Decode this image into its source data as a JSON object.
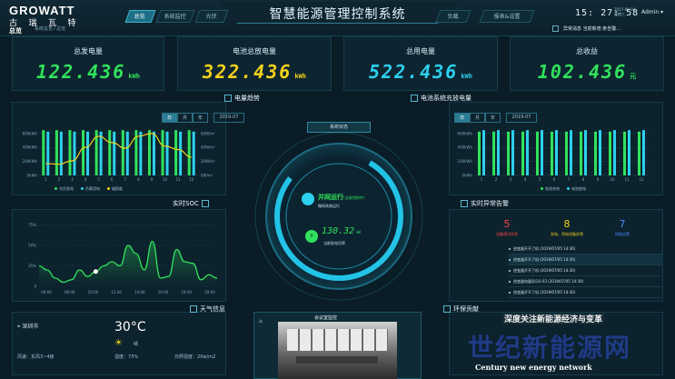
{
  "header": {
    "logo_en": "GROWATT",
    "logo_cn": "古 瑞 瓦 特",
    "logo_sub": "系统总览 / 总览",
    "overview": "总览",
    "title": "智慧能源管理控制系统",
    "clock": "15: 27: 58",
    "date": "2017-09-04",
    "weekday": "星期三",
    "admin": "Admin",
    "alarm": "异常消息  当前新增:条告警…"
  },
  "nav_left": [
    {
      "label": "总览",
      "active": true
    },
    {
      "label": "系统监控",
      "active": false
    },
    {
      "label": "光伏",
      "active": false
    }
  ],
  "nav_right": [
    {
      "label": "负载",
      "active": false
    },
    {
      "label": "报表&设置",
      "active": false
    }
  ],
  "kpis": [
    {
      "label": "总发电量",
      "value": "122.436",
      "unit": "kWh",
      "color": "#31e25c"
    },
    {
      "label": "电池总放电量",
      "value": "322.436",
      "unit": "kWh",
      "color": "#f5d21b"
    },
    {
      "label": "总用电量",
      "value": "522.436",
      "unit": "kWh",
      "color": "#2dd0ee"
    },
    {
      "label": "总收益",
      "value": "102.436",
      "unit": "元",
      "color": "#31e25c"
    }
  ],
  "energy_trend": {
    "title": "电量趋势",
    "tabs": [
      "日",
      "月",
      "年"
    ],
    "active_tab": "日",
    "date": "2019-07"
  },
  "battery_panel": {
    "title": "电池系统充放电量",
    "tabs": [
      "日",
      "月",
      "年"
    ],
    "active_tab": "日",
    "date": "2019-07"
  },
  "soc_panel": {
    "title": "实时SOC"
  },
  "alarm_panel": {
    "title": "实时异常告警",
    "counts": [
      {
        "value": "5",
        "label": "设备通讯异常",
        "color": "#ff4747"
      },
      {
        "value": "8",
        "label": "发电、用电设备异常",
        "color": "#f5d21b"
      },
      {
        "value": "7",
        "label": "网络告警",
        "color": "#4c8cff"
      }
    ],
    "items": [
      "逆变器开不了机  (2019/07/05 14:30)",
      "逆变器开不了机  (2019/07/05 14:30)",
      "逆变器开不了机  (2019/07/05 14:30)",
      "逆变器电量异乐0.03  (2019/07/05 14:30)",
      "逆变器开不了机  (2019/07/05 14:30)"
    ]
  },
  "center": {
    "button": "系统状态",
    "status": "并网运行",
    "status_note": "(当前控制中)",
    "status_sub": "微网系统运行",
    "power": "130.32",
    "power_unit": "kW",
    "power_label": "当前发电功率"
  },
  "weather": {
    "title": "天气信息",
    "city": "深圳市",
    "temp": "30°C",
    "cond": "晴",
    "wind": "风速：东风3~4级",
    "humidity": "湿度：73%",
    "sun_label": "日照强度：",
    "sun_value": "20w/m2"
  },
  "camera": {
    "title": "会议室监控"
  },
  "eco": {
    "title": "环保贡献"
  },
  "watermark": {
    "line1": "深度关注新能源经济与变革",
    "line2": "世纪新能源网",
    "line3": "Century new energy network"
  },
  "chart_data": [
    {
      "type": "bar",
      "title": "电量趋势",
      "categories": [
        "1",
        "2",
        "3",
        "4",
        "5",
        "6",
        "7",
        "8",
        "9",
        "10",
        "11",
        "12"
      ],
      "series": [
        {
          "name": "光伏发电",
          "values": [
            600,
            600,
            600,
            600,
            600,
            600,
            600,
            600,
            600,
            600,
            600,
            600
          ]
        },
        {
          "name": "负载用电",
          "values": [
            580,
            580,
            580,
            580,
            580,
            580,
            580,
            580,
            580,
            580,
            580,
            580
          ]
        },
        {
          "name": "辐照度",
          "type": "line",
          "values": [
            17,
            16,
            21,
            40,
            56,
            47,
            39,
            56,
            60,
            42,
            37,
            26
          ]
        }
      ],
      "yticks": [
        "0kWh",
        "200kWh",
        "400kWh",
        "600kWh"
      ],
      "y2ticks": [
        "0W/m²",
        "20W/m²",
        "40W/m²",
        "60W/m²"
      ],
      "ylim": [
        0,
        650
      ],
      "y2lim": [
        0,
        65
      ]
    },
    {
      "type": "bar",
      "title": "电池系统充放电量",
      "categories": [
        "1",
        "2",
        "3",
        "4",
        "5",
        "6",
        "7",
        "8",
        "9",
        "10",
        "11",
        "12"
      ],
      "series": [
        {
          "name": "电池充电",
          "values": [
            580,
            580,
            580,
            580,
            580,
            580,
            580,
            580,
            580,
            580,
            580,
            580
          ]
        },
        {
          "name": "电池放电",
          "values": [
            600,
            600,
            600,
            600,
            600,
            600,
            600,
            600,
            600,
            600,
            600,
            600
          ]
        }
      ],
      "yticks": [
        "0kWh",
        "200kWh",
        "400kWh",
        "600kWh"
      ],
      "ylim": [
        0,
        650
      ]
    },
    {
      "type": "line",
      "title": "实时SOC",
      "x": [
        "06:00",
        "08:00",
        "10:00",
        "12:00",
        "14:00",
        "16:00",
        "18:00",
        "20:00"
      ],
      "series": [
        {
          "values": [
            25,
            20,
            10,
            5,
            8,
            20,
            12,
            18,
            25,
            30,
            25,
            50,
            40,
            20,
            55,
            10,
            12,
            45,
            30,
            28,
            8,
            14,
            10
          ]
        }
      ],
      "yticks": [
        "0",
        "25%",
        "50%",
        "75%"
      ],
      "ylim": [
        0,
        80
      ]
    }
  ]
}
